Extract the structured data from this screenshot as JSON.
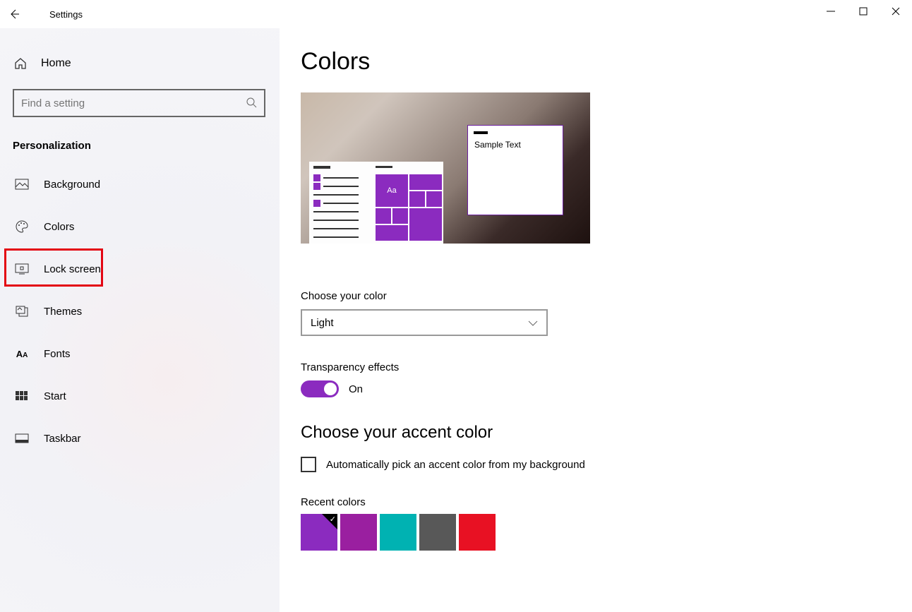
{
  "window": {
    "title": "Settings"
  },
  "sidebar": {
    "home": "Home",
    "search_placeholder": "Find a setting",
    "section": "Personalization",
    "items": [
      {
        "label": "Background"
      },
      {
        "label": "Colors"
      },
      {
        "label": "Lock screen"
      },
      {
        "label": "Themes"
      },
      {
        "label": "Fonts"
      },
      {
        "label": "Start"
      },
      {
        "label": "Taskbar"
      }
    ]
  },
  "page": {
    "heading": "Colors",
    "preview_sample": "Sample Text",
    "preview_tile": "Aa",
    "choose_color_label": "Choose your color",
    "choose_color_value": "Light",
    "transparency_label": "Transparency effects",
    "transparency_value": "On",
    "accent_heading": "Choose your accent color",
    "auto_pick_label": "Automatically pick an accent color from my background",
    "recent_label": "Recent colors",
    "recent_colors": [
      "#8b2bbf",
      "#9a1fa0",
      "#00b2b2",
      "#585858",
      "#e81123"
    ],
    "accent_purple": "#8b2bbf"
  }
}
